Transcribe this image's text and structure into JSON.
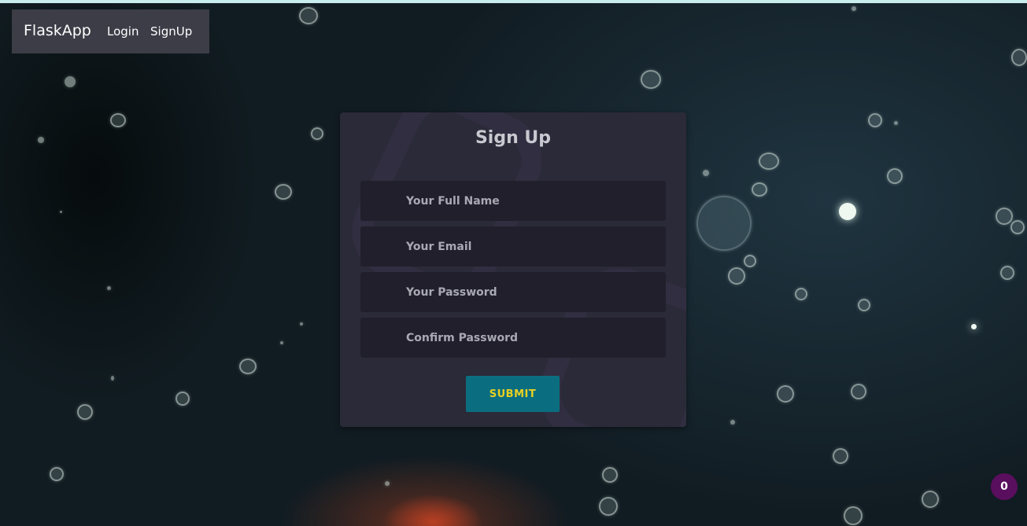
{
  "navbar": {
    "brand": "FlaskApp",
    "links": [
      "Login",
      "SignUp"
    ]
  },
  "form": {
    "title": "Sign Up",
    "fields": [
      {
        "placeholder": "Your Full Name"
      },
      {
        "placeholder": "Your Email"
      },
      {
        "placeholder": "Your Password"
      },
      {
        "placeholder": "Confirm Password"
      }
    ],
    "submit_label": "SUBMIT"
  },
  "badge": {
    "count": "0"
  },
  "colors": {
    "navbar_bg": "#3c3d47",
    "card_bg": "#2b2a38",
    "input_bg": "#211f2b",
    "submit_bg": "#0b6e80",
    "submit_text": "#e8d022",
    "badge_bg": "#5a0e5e"
  }
}
